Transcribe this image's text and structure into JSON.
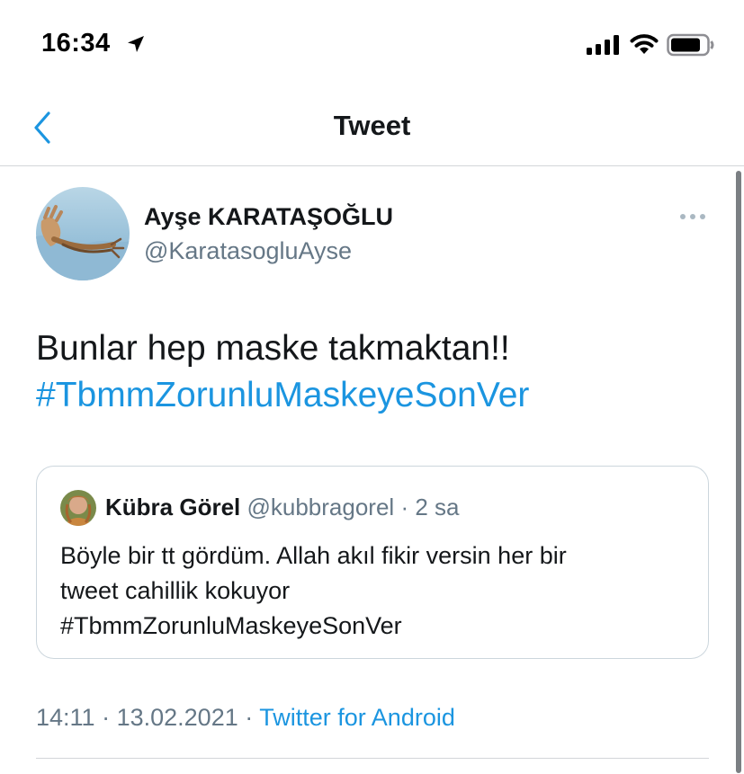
{
  "status_bar": {
    "time": "16:34",
    "icons": [
      "location-arrow-icon",
      "cellular-signal-icon",
      "wifi-icon",
      "battery-icon"
    ]
  },
  "nav": {
    "title": "Tweet",
    "back_icon": "chevron-left-icon",
    "accent_color": "#1b95e0"
  },
  "tweet": {
    "author": {
      "name": "Ayşe KARATAŞOĞLU",
      "handle": "@KaratasogluAyse"
    },
    "more_icon": "ellipsis-icon",
    "text_line": "Bunlar hep maske takmaktan!!",
    "hashtag": "#TbmmZorunluMaskeyeSonVer",
    "quoted": {
      "name": "Kübra Görel",
      "handle": "@kubbragorel",
      "separator": "·",
      "age": "2 sa",
      "lines": [
        "Böyle bir tt gördüm. Allah akıl fikir versin her bir",
        "tweet cahillik kokuyor",
        "#TbmmZorunluMaskeyeSonVer"
      ]
    },
    "time": "14:11",
    "date": "13.02.2021",
    "meta_separator": "·",
    "source": "Twitter for Android"
  },
  "colors": {
    "text": "#14171a",
    "secondary": "#657786",
    "link": "#1b95e0",
    "border": "#ccd6dd"
  }
}
